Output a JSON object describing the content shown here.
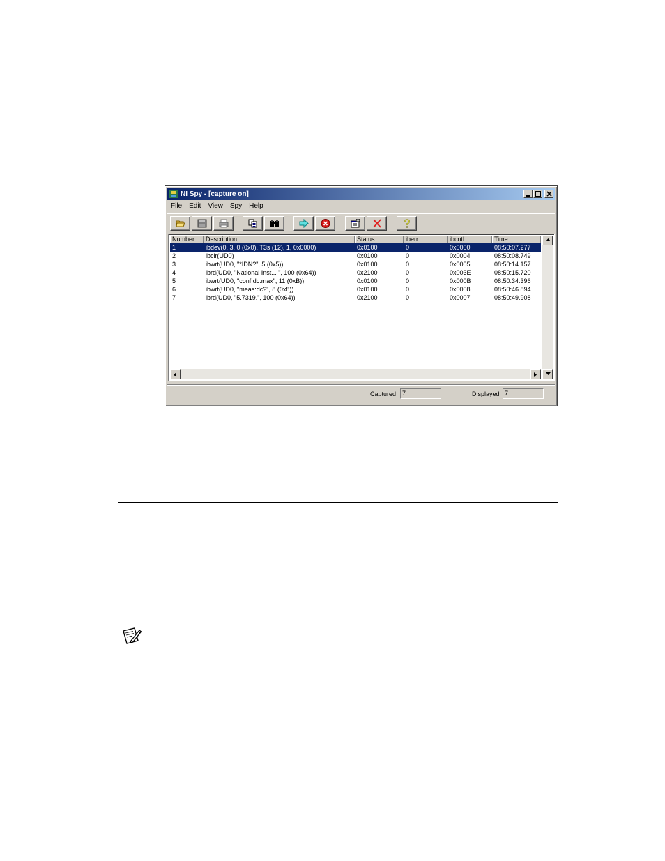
{
  "window": {
    "title": "NI Spy - [capture on]"
  },
  "menu": [
    "File",
    "Edit",
    "View",
    "Spy",
    "Help"
  ],
  "toolbar": [
    {
      "icon": "open-folder-icon"
    },
    {
      "icon": "save-icon"
    },
    {
      "icon": "print-icon"
    },
    {
      "icon": "copy-icon"
    },
    {
      "icon": "find-binoculars-icon"
    },
    {
      "icon": "start-capture-arrow-icon"
    },
    {
      "icon": "stop-capture-icon"
    },
    {
      "icon": "properties-icon"
    },
    {
      "icon": "clear-delete-icon"
    },
    {
      "icon": "help-icon"
    }
  ],
  "table": {
    "columns": [
      "Number",
      "Description",
      "Status",
      "iberr",
      "ibcntl",
      "Time"
    ],
    "rows": [
      [
        "1",
        "ibdev(0, 3, 0 (0x0), T3s (12), 1, 0x0000)",
        "0x0100",
        "0",
        "0x0000",
        "08:50:07.277"
      ],
      [
        "2",
        "ibclr(UD0)",
        "0x0100",
        "0",
        "0x0004",
        "08:50:08.749"
      ],
      [
        "3",
        "ibwrt(UD0, \"*IDN?\", 5 (0x5))",
        "0x0100",
        "0",
        "0x0005",
        "08:50:14.157"
      ],
      [
        "4",
        "ibrd(UD0, \"National Inst... \", 100 (0x64))",
        "0x2100",
        "0",
        "0x003E",
        "08:50:15.720"
      ],
      [
        "5",
        "ibwrt(UD0, \"conf:dc:max\", 11 (0xB))",
        "0x0100",
        "0",
        "0x000B",
        "08:50:34.396"
      ],
      [
        "6",
        "ibwrt(UD0, \"meas:dc?\", 8 (0x8))",
        "0x0100",
        "0",
        "0x0008",
        "08:50:46.894"
      ],
      [
        "7",
        "ibrd(UD0, \"5.7319.\", 100 (0x64))",
        "0x2100",
        "0",
        "0x0007",
        "08:50:49.908"
      ]
    ],
    "selected_row": 0
  },
  "status": {
    "captured_label": "Captured",
    "captured_value": "7",
    "displayed_label": "Displayed",
    "displayed_value": "7"
  },
  "colors": {
    "title_bar": "#0a246a",
    "selection": "#0a246a",
    "window_face": "#d4d0c8"
  }
}
